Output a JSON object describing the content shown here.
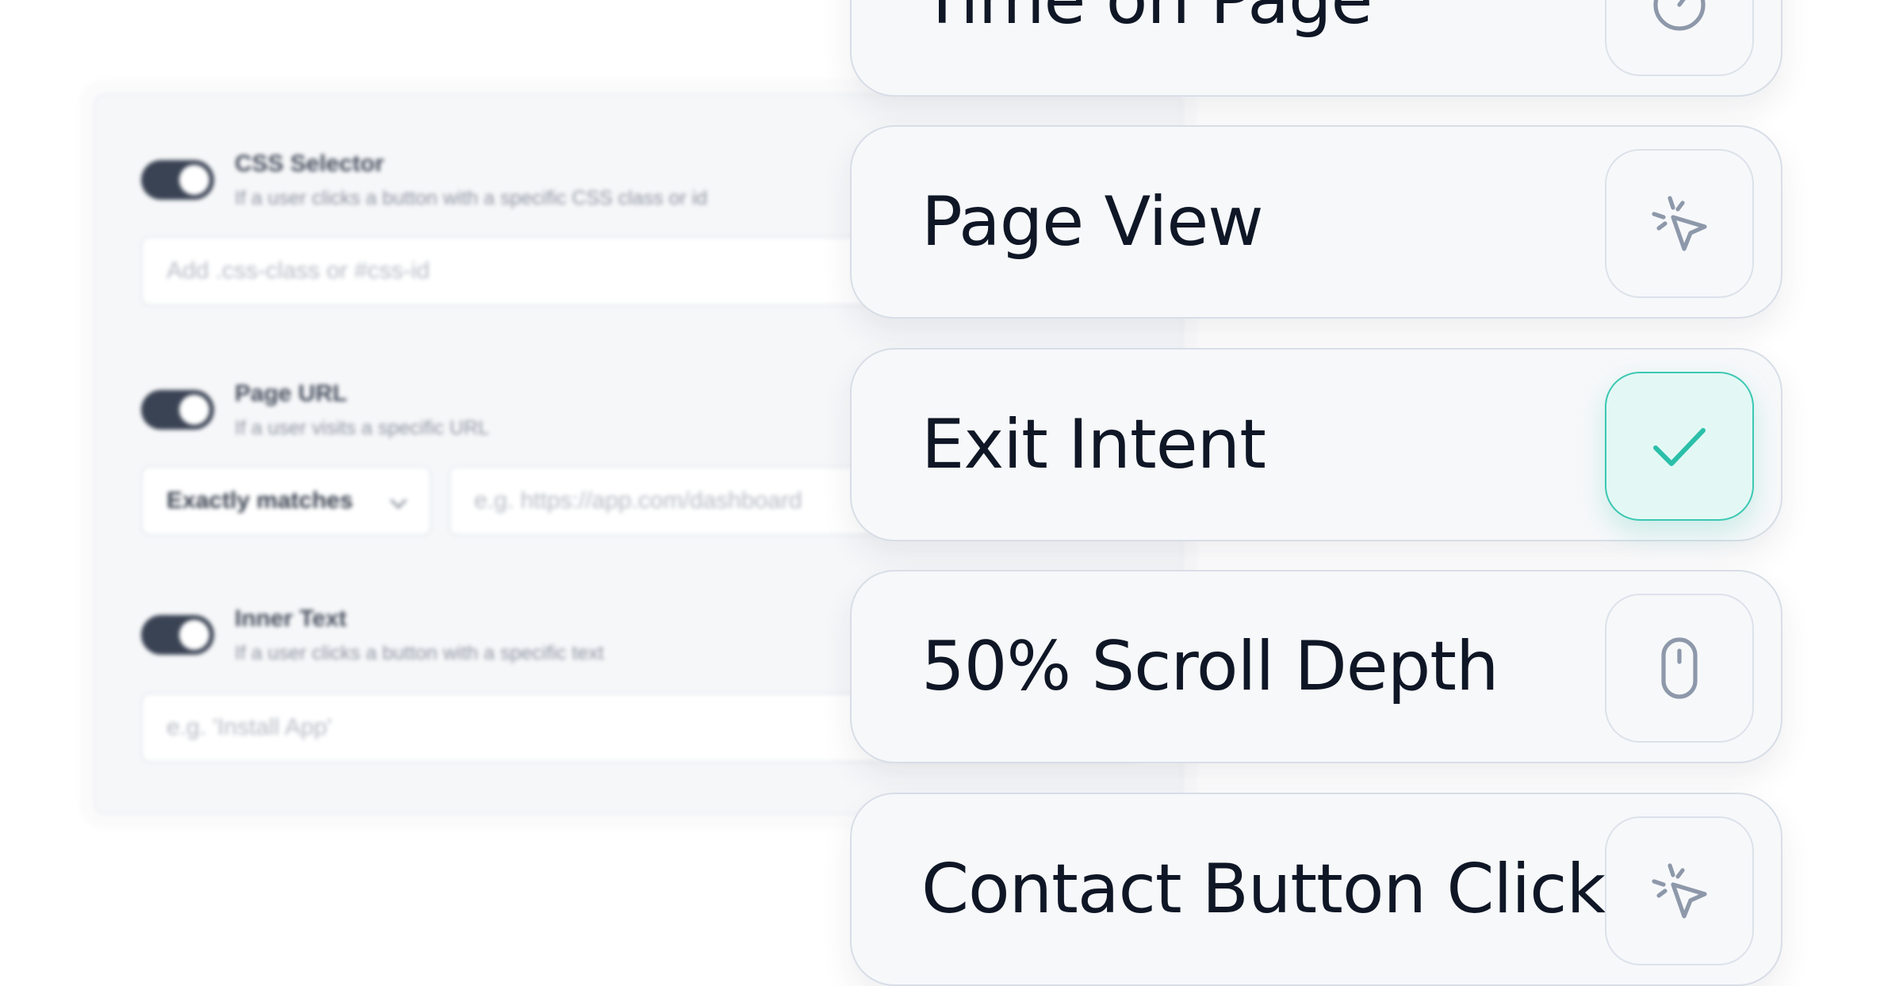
{
  "settings_panel": {
    "rules": [
      {
        "title": "CSS Selector",
        "description": "If a user clicks a button with a specific CSS class or id",
        "enabled": true,
        "input_placeholder": "Add .css-class or #css-id"
      },
      {
        "title": "Page URL",
        "description": "If a user visits a specific URL",
        "enabled": true,
        "match_select_value": "Exactly matches",
        "input_placeholder": "e.g. https://app.com/dashboard"
      },
      {
        "title": "Inner Text",
        "description": "If a user clicks a button with a specific text",
        "enabled": true,
        "input_placeholder": "e.g. 'Install App'"
      }
    ]
  },
  "triggers": [
    {
      "label": "Time on Page",
      "icon": "timer-icon",
      "selected": false
    },
    {
      "label": "Page View",
      "icon": "cursor-click-icon",
      "selected": false
    },
    {
      "label": "Exit Intent",
      "icon": "check-icon",
      "selected": true
    },
    {
      "label": "50% Scroll Depth",
      "icon": "mouse-icon",
      "selected": false
    },
    {
      "label": "Contact Button Click",
      "icon": "cursor-click-icon",
      "selected": false
    }
  ],
  "colors": {
    "text_dark": "#0f1726",
    "card_background": "#f7f8fa",
    "accent": "#2bbfa9",
    "accent_background": "#e3f8f5",
    "icon_gray": "#8d98aa",
    "toggle_on": "#3a4354"
  }
}
